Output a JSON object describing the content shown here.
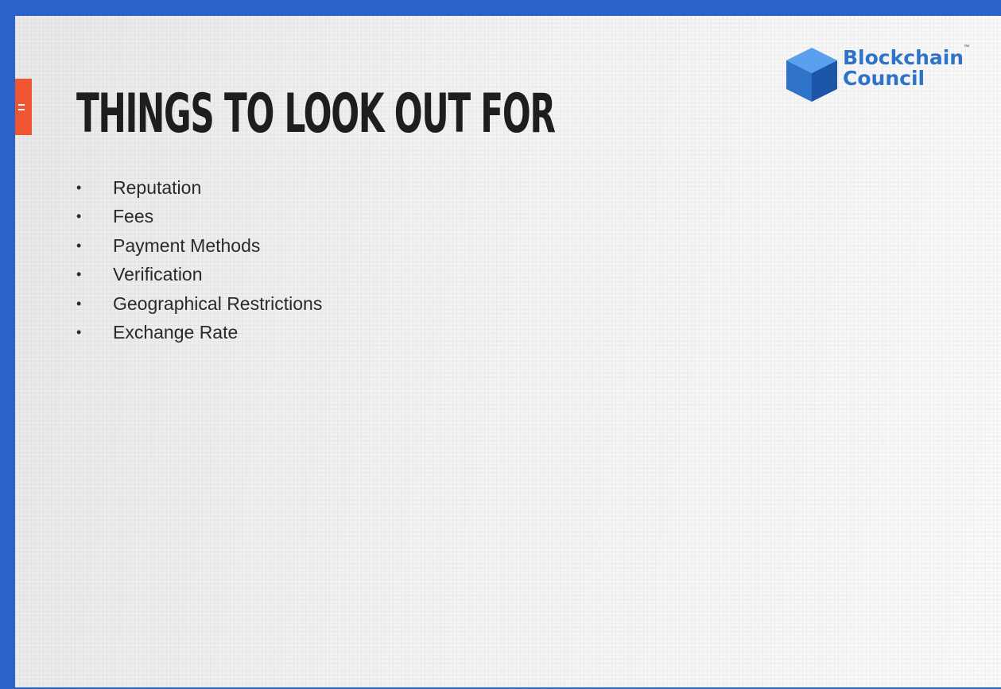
{
  "slide": {
    "title": "THINGS TO LOOK OUT FOR",
    "bullet_symbol": "•",
    "bullets": [
      "Reputation",
      "Fees",
      "Payment Methods",
      "Verification",
      "Geographical Restrictions",
      "Exchange Rate"
    ]
  },
  "logo": {
    "line1": "Blockchain",
    "line2": "Council",
    "trademark": "™"
  },
  "colors": {
    "frame_blue": "#2a62c9",
    "accent_orange": "#ef5533",
    "logo_blue": "#2f73c9",
    "title_text": "#1e1e1e"
  },
  "icons": {
    "logo_mark": "blue-cube-icon",
    "accent": "menu-lines-icon"
  }
}
